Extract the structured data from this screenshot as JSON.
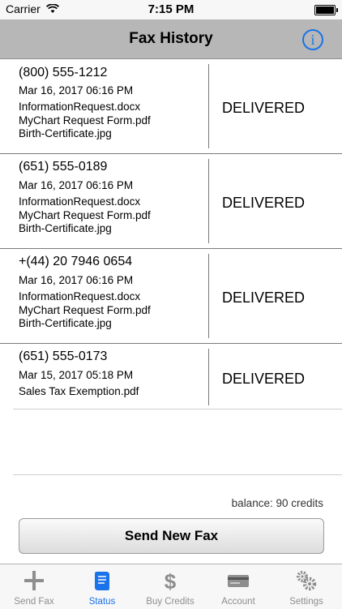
{
  "status_bar": {
    "carrier": "Carrier",
    "time": "7:15 PM"
  },
  "nav": {
    "title": "Fax History"
  },
  "faxes": [
    {
      "phone": "(800) 555-1212",
      "date": "Mar 16, 2017 06:16 PM",
      "files": [
        "InformationRequest.docx",
        "MyChart Request Form.pdf",
        "Birth-Certificate.jpg"
      ],
      "status": "DELIVERED"
    },
    {
      "phone": "(651) 555-0189",
      "date": "Mar 16, 2017 06:16 PM",
      "files": [
        "InformationRequest.docx",
        "MyChart Request Form.pdf",
        "Birth-Certificate.jpg"
      ],
      "status": "DELIVERED"
    },
    {
      "phone": "+(44) 20 7946 0654",
      "date": "Mar 16, 2017 06:16 PM",
      "files": [
        "InformationRequest.docx",
        "MyChart Request Form.pdf",
        "Birth-Certificate.jpg"
      ],
      "status": "DELIVERED"
    },
    {
      "phone": "(651) 555-0173",
      "date": "Mar 15, 2017 05:18 PM",
      "files": [
        "Sales Tax Exemption.pdf"
      ],
      "status": "DELIVERED"
    }
  ],
  "balance": "balance: 90 credits",
  "send_button": "Send New Fax",
  "tabs": [
    {
      "label": "Send Fax",
      "icon": "plus-icon",
      "active": false
    },
    {
      "label": "Status",
      "icon": "scroll-icon",
      "active": true
    },
    {
      "label": "Buy Credits",
      "icon": "dollar-icon",
      "active": false
    },
    {
      "label": "Account",
      "icon": "card-icon",
      "active": false
    },
    {
      "label": "Settings",
      "icon": "gears-icon",
      "active": false
    }
  ],
  "colors": {
    "accent": "#1a73e8",
    "nav_bg": "#b7b7b7",
    "tab_inactive": "#8e8e8e"
  }
}
